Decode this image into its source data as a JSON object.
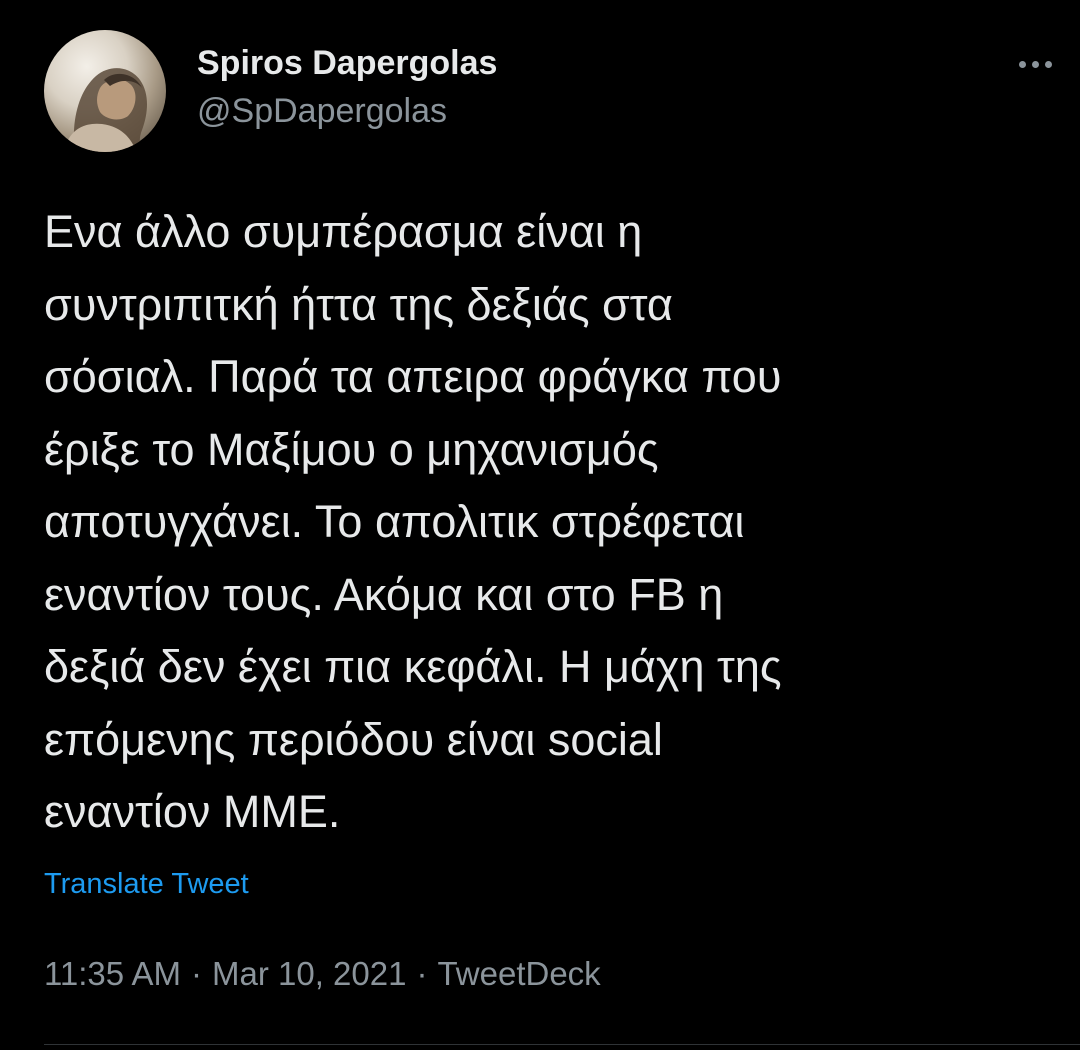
{
  "author": {
    "display_name": "Spiros Dapergolas",
    "handle": "@SpDapergolas",
    "avatar": "profile-photo"
  },
  "more_icon": "more-horizontal-icon",
  "tweet": {
    "lines": [
      "Ενα άλλο συμπέρασμα είναι η",
      "συντριπιτκή ήττα της δεξιάς στα",
      "σόσιαλ. Παρά τα απειρα φράγκα που",
      "έριξε το Μαξίμου ο μηχανισμός",
      "αποτυγχάνει. Το απολιτικ στρέφεται",
      "εναντίον τους. Ακόμα και στο FB η",
      "δεξιά δεν έχει πια κεφάλι. Η μάχη της",
      "επόμενης περιόδου είναι social",
      "εναντίον ΜΜΕ."
    ]
  },
  "translate_label": "Translate Tweet",
  "meta": {
    "time": "11:35 AM",
    "separator": "·",
    "date": "Mar 10, 2021",
    "source": "TweetDeck"
  },
  "colors": {
    "background": "#000000",
    "text": "#e7e9ea",
    "secondary": "#8b949b",
    "link": "#1d9bf0"
  }
}
